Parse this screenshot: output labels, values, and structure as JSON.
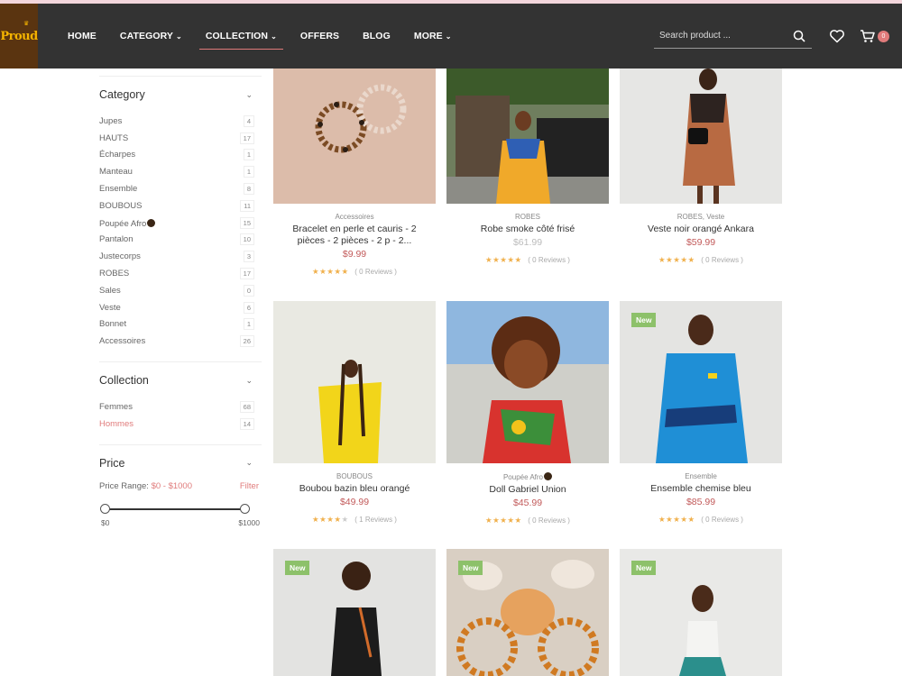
{
  "brand": {
    "logo_text": "Proud"
  },
  "nav": [
    {
      "label": "HOME",
      "dropdown": false,
      "active": false
    },
    {
      "label": "CATEGORY",
      "dropdown": true,
      "active": false
    },
    {
      "label": "COLLECTION",
      "dropdown": true,
      "active": true
    },
    {
      "label": "OFFERS",
      "dropdown": false,
      "active": false
    },
    {
      "label": "BLOG",
      "dropdown": false,
      "active": false
    },
    {
      "label": "MORE",
      "dropdown": true,
      "active": false
    }
  ],
  "search": {
    "placeholder": "Search product ..."
  },
  "cart": {
    "count": "0"
  },
  "sidebar": {
    "category": {
      "title": "Category",
      "items": [
        {
          "label": "Jupes",
          "count": "4"
        },
        {
          "label": "HAUTS",
          "count": "17"
        },
        {
          "label": "Écharpes",
          "count": "1"
        },
        {
          "label": "Manteau",
          "count": "1"
        },
        {
          "label": "Ensemble",
          "count": "8"
        },
        {
          "label": "BOUBOUS",
          "count": "11"
        },
        {
          "label": "Poupée Afro",
          "count": "15"
        },
        {
          "label": "Pantalon",
          "count": "10"
        },
        {
          "label": "Justecorps",
          "count": "3"
        },
        {
          "label": "ROBES",
          "count": "17"
        },
        {
          "label": "Sales",
          "count": "0"
        },
        {
          "label": "Veste",
          "count": "6"
        },
        {
          "label": "Bonnet",
          "count": "1"
        },
        {
          "label": "Accessoires",
          "count": "26"
        }
      ]
    },
    "collection": {
      "title": "Collection",
      "items": [
        {
          "label": "Femmes",
          "count": "68"
        },
        {
          "label": "Hommes",
          "count": "14"
        }
      ]
    },
    "price": {
      "title": "Price",
      "range_label": "Price Range:",
      "range_value": "$0 - $1000",
      "filter_label": "Filter",
      "min": "$0",
      "max": "$1000"
    }
  },
  "products": [
    {
      "category": "Accessoires",
      "name": "Bracelet en perle et cauris - 2 pièces - 2 pièces - 2 p - 2...",
      "price": "$9.99",
      "reviews": "( 0 Reviews )",
      "stars": 5,
      "new": false
    },
    {
      "category": "ROBES",
      "name": "Robe smoke côté frisé",
      "price": "$61.99",
      "reviews": "( 0 Reviews )",
      "stars": 5,
      "new": false
    },
    {
      "category": "ROBES, Veste",
      "name": "Veste noir orangé Ankara",
      "price": "$59.99",
      "reviews": "( 0 Reviews )",
      "stars": 5,
      "new": false
    },
    {
      "category": "BOUBOUS",
      "name": "Boubou bazin bleu orangé",
      "price": "$49.99",
      "reviews": "( 1 Reviews )",
      "stars": 4,
      "new": false
    },
    {
      "category": "Poupée Afro",
      "name": "Doll Gabriel Union",
      "price": "$45.99",
      "reviews": "( 0 Reviews )",
      "stars": 5,
      "new": false
    },
    {
      "category": "Ensemble",
      "name": "Ensemble chemise bleu",
      "price": "$85.99",
      "reviews": "( 0 Reviews )",
      "stars": 5,
      "new": true,
      "badge": "New"
    },
    {
      "new": true,
      "badge": "New"
    },
    {
      "new": true,
      "badge": "New"
    },
    {
      "new": true,
      "badge": "New"
    }
  ],
  "colors": {
    "accent": "#e07b7b",
    "header": "#333333",
    "star": "#f0b04c",
    "new_badge": "#8dc16a"
  }
}
